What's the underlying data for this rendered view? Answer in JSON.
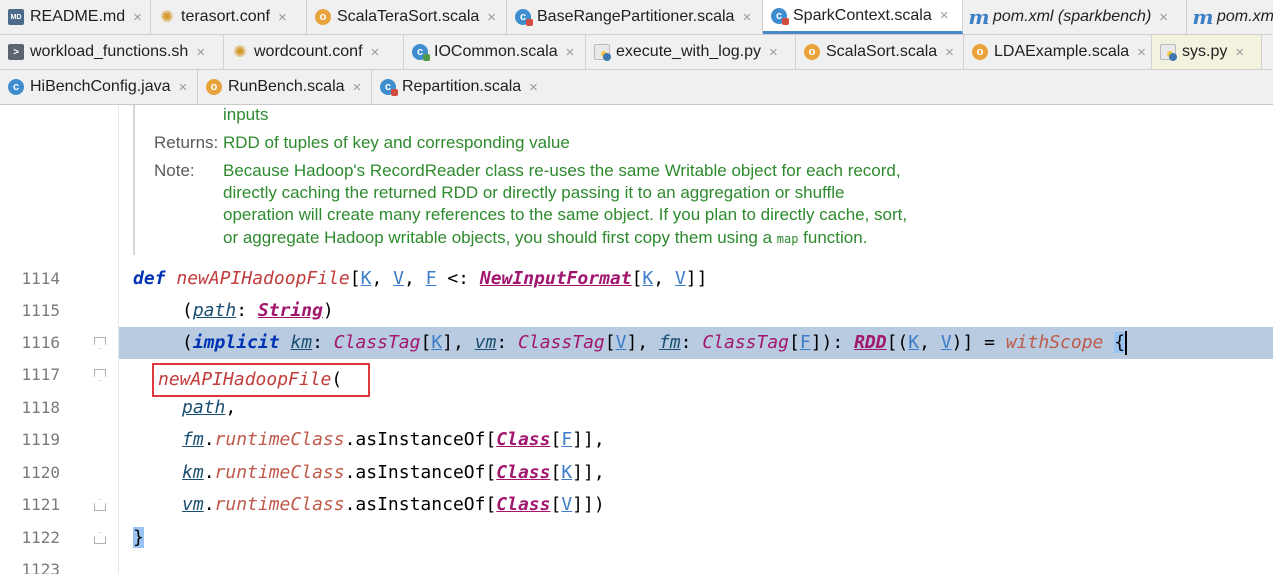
{
  "tabs": {
    "row1": [
      {
        "label": "README.md",
        "icon": "markdown-file-icon",
        "active": false
      },
      {
        "label": "terasort.conf",
        "icon": "config-gear-icon",
        "active": false
      },
      {
        "label": "ScalaTeraSort.scala",
        "icon": "scala-object-icon",
        "active": false
      },
      {
        "label": "BaseRangePartitioner.scala",
        "icon": "scala-class-icon",
        "active": false
      },
      {
        "label": "SparkContext.scala",
        "icon": "scala-class-icon",
        "active": true
      },
      {
        "label": "pom.xml (sparkbench)",
        "icon": "maven-icon",
        "active": false
      },
      {
        "label": "pom.xm",
        "icon": "maven-icon",
        "active": false
      }
    ],
    "row2": [
      {
        "label": "workload_functions.sh",
        "icon": "shell-script-icon",
        "active": false
      },
      {
        "label": "wordcount.conf",
        "icon": "config-gear-icon",
        "active": false
      },
      {
        "label": "IOCommon.scala",
        "icon": "scala-class-icon",
        "active": false
      },
      {
        "label": "execute_with_log.py",
        "icon": "python-file-icon",
        "active": false
      },
      {
        "label": "ScalaSort.scala",
        "icon": "scala-object-icon",
        "active": false
      },
      {
        "label": "LDAExample.scala",
        "icon": "scala-object-icon",
        "active": false
      },
      {
        "label": "sys.py",
        "icon": "python-file-icon",
        "active": false
      }
    ],
    "row3": [
      {
        "label": "HiBenchConfig.java",
        "icon": "java-class-icon",
        "active": false
      },
      {
        "label": "RunBench.scala",
        "icon": "scala-object-icon",
        "active": false
      },
      {
        "label": "Repartition.scala",
        "icon": "scala-class-icon",
        "active": false
      }
    ],
    "close_glyph": "×"
  },
  "doc": {
    "inputs_line": "inputs",
    "returns_label": "Returns:",
    "returns_text": "RDD of tuples of key and corresponding value",
    "note_label": "Note:",
    "note_lines": [
      "Because Hadoop's RecordReader class re-uses the same Writable object for each record,",
      "directly caching the returned RDD or directly passing it to an aggregation or shuffle",
      "operation will create many references to the same object. If you plan to directly cache, sort,"
    ],
    "note_last_prefix": "or aggregate Hadoop writable objects, you should first copy them using a ",
    "note_last_code": "map",
    "note_last_suffix": " function."
  },
  "line_numbers": [
    "1114",
    "1115",
    "1116",
    "1117",
    "1118",
    "1119",
    "1120",
    "1121",
    "1122",
    "1123"
  ],
  "code": {
    "l1114": {
      "def": "def",
      "name": "newAPIHadoopFile",
      "lb": "[",
      "K": "K",
      ", ": ", ",
      "V": "V",
      ",2": ", ",
      "F": "F",
      "bound": " <: ",
      "nif": "NewInputFormat",
      "lb2": "[",
      "K2": "K",
      ",3": ", ",
      "V2": "V",
      "rb": "]]"
    },
    "l1115": {
      "open": "(",
      "path": "path",
      "colon": ": ",
      "String": "String",
      "close": ")"
    },
    "l1116": {
      "open": "(",
      "implicit": "implicit",
      "km": "km",
      "c1": ": ",
      "ct1": "ClassTag",
      "b1": "[",
      "K": "K",
      "e1": "], ",
      "vm": "vm",
      "c2": ": ",
      "ct2": "ClassTag",
      "b2": "[",
      "V": "V",
      "e2": "], ",
      "fm": "fm",
      "c3": ": ",
      "ct3": "ClassTag",
      "b3": "[",
      "F": "F",
      "e3": "]): ",
      "RDD": "RDD",
      "b4": "[(",
      "K2": "K",
      "c4": ", ",
      "V2": "V",
      "e4": ")] = ",
      "withScope": "withScope",
      "brace": "{"
    },
    "l1117": {
      "call": "newAPIHadoopFile",
      "open": "("
    },
    "l1118": {
      "path": "path",
      "comma": ","
    },
    "l1119": {
      "fm": "fm",
      "dot": ".",
      "rc": "runtimeClass",
      "ai": ".asInstanceOf[",
      "cls": "Class",
      "b": "[",
      "F": "F",
      "e": "]],"
    },
    "l1120": {
      "km": "km",
      "dot": ".",
      "rc": "runtimeClass",
      "ai": ".asInstanceOf[",
      "cls": "Class",
      "b": "[",
      "K": "K",
      "e": "]],"
    },
    "l1121": {
      "vm": "vm",
      "dot": ".",
      "rc": "runtimeClass",
      "ai": ".asInstanceOf[",
      "cls": "Class",
      "b": "[",
      "V": "V",
      "e": "]])"
    },
    "l1122": {
      "brace": "}"
    }
  },
  "colors": {
    "highlight_line": "#b8cbe0",
    "annotation_box": "#e0393e",
    "doc_text": "#2d8a2d",
    "active_tab_underline": "#4a88c7"
  }
}
